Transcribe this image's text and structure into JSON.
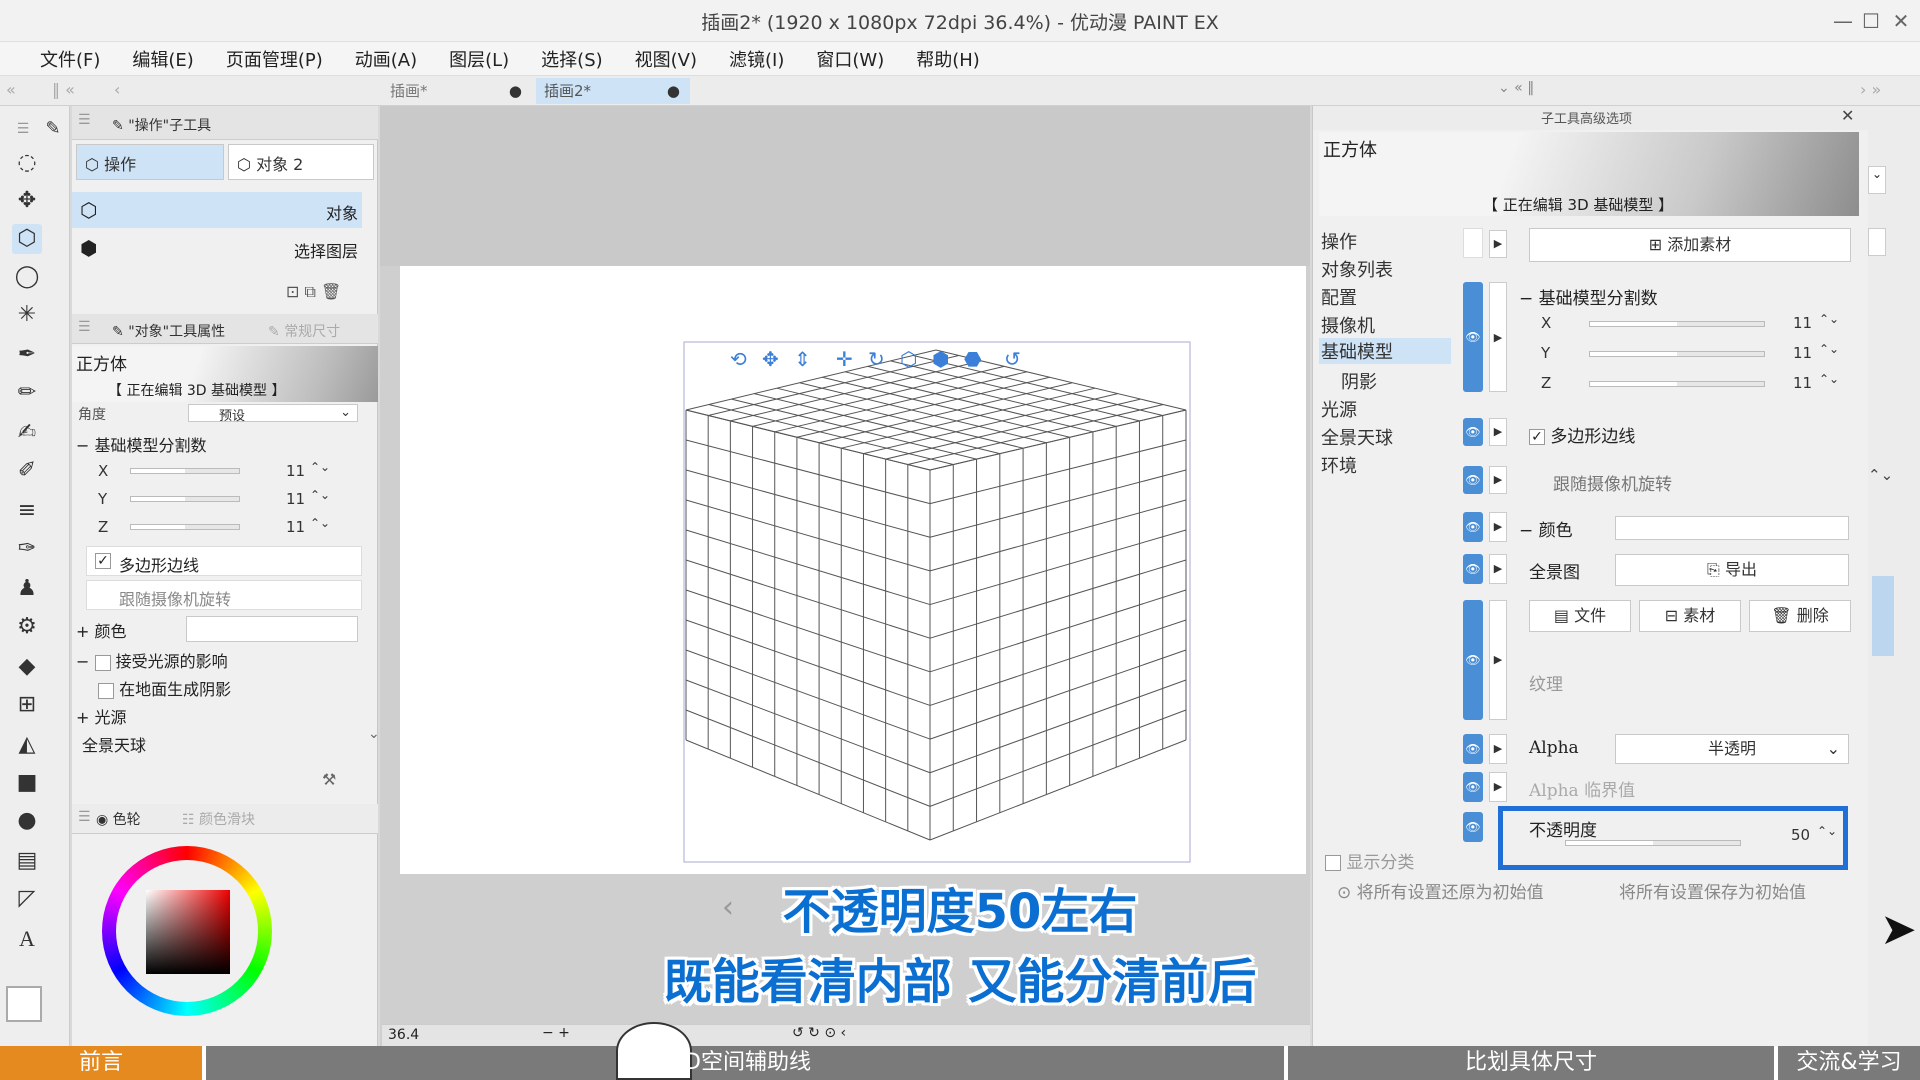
{
  "window": {
    "title": "插画2* (1920 x 1080px 72dpi 36.4%)  - 优动漫 PAINT EX",
    "minimize": "—",
    "maximize": "☐",
    "close": "✕"
  },
  "menu": [
    "文件(F)",
    "编辑(E)",
    "页面管理(P)",
    "动画(A)",
    "图层(L)",
    "选择(S)",
    "视图(V)",
    "滤镜(I)",
    "窗口(W)",
    "帮助(H)"
  ],
  "tabs": [
    {
      "label": "插画*",
      "dot": "●"
    },
    {
      "label": "插画2*",
      "dot": "●"
    }
  ],
  "subtool_panel": {
    "header": "\"操作\"子工具",
    "btn_operate": "操作",
    "btn_object": "对象 2",
    "list": [
      {
        "label": "对象"
      },
      {
        "label": "选择图层"
      }
    ]
  },
  "tool_property": {
    "header": "\"对象\"工具属性",
    "header2": "常规尺寸",
    "preview_title": "正方体",
    "preview_caption": "【 正在编辑 3D 基础模型 】",
    "angle_label": "角度",
    "angle_value": "预设",
    "division_label": "基础模型分割数",
    "x_label": "X",
    "x_value": "11",
    "y_label": "Y",
    "y_value": "11",
    "z_label": "Z",
    "z_value": "11",
    "polygon_edge": "多边形边线",
    "follow_camera": "跟随摄像机旋转",
    "color_label": "颜色",
    "light_affect": "接受光源的影响",
    "ground_shadow": "在地面生成阴影",
    "light_source": "光源",
    "panorama": "全景天球"
  },
  "color_panel": {
    "tab1": "色轮",
    "tab2": "颜色滑块"
  },
  "advanced_panel": {
    "header": "子工具高级选项",
    "close": "✕",
    "preview_title": "正方体",
    "preview_caption": "【 正在编辑 3D 基础模型 】",
    "categories": [
      "操作",
      "对象列表",
      "配置",
      "摄像机",
      "基础模型",
      "阴影",
      "光源",
      "全景天球",
      "环境"
    ],
    "selected_category": "基础模型",
    "add_material": "添加素材",
    "division_label": "基础模型分割数",
    "x_label": "X",
    "x_value": "11",
    "y_label": "Y",
    "y_value": "11",
    "z_label": "Z",
    "z_value": "11",
    "polygon_edge": "多边形边线",
    "follow_camera": "跟随摄像机旋转",
    "color_label": "颜色",
    "panorama_label": "全景图",
    "export": "导出",
    "file_btn": "文件",
    "material_btn": "素材",
    "delete_btn": "删除",
    "texture_label": "纹理",
    "alpha_label": "Alpha",
    "alpha_value": "半透明",
    "alpha_threshold": "Alpha 临界值",
    "opacity_label": "不透明度",
    "opacity_value": "50",
    "show_category": "显示分类",
    "reset_all": "将所有设置还原为初始值",
    "save_all": "将所有设置保存为初始值"
  },
  "status": {
    "zoom": "36.4"
  },
  "subtitles": {
    "line1": "不透明度50左右",
    "line2": "既能看清内部 又能分清前后"
  },
  "bottom_bar": {
    "items": [
      "前言",
      "3D空间辅助线",
      "比划具体尺寸",
      "交流&学习"
    ]
  },
  "colors": {
    "accent": "#1f6fd6",
    "bottom_bar": "#e58a1f",
    "subtitle": "#0b6fd1"
  }
}
